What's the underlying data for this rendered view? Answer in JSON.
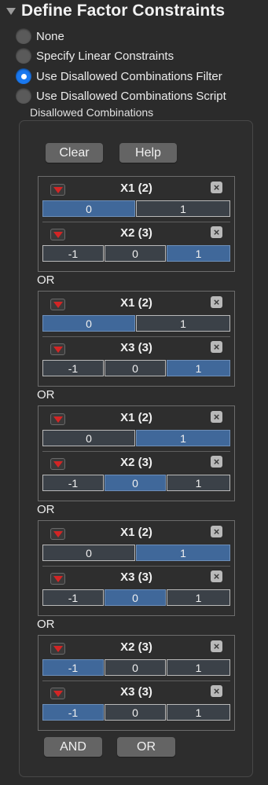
{
  "header": {
    "title": "Define Factor Constraints"
  },
  "radios": [
    {
      "label": "None",
      "selected": false
    },
    {
      "label": "Specify Linear Constraints",
      "selected": false
    },
    {
      "label": "Use Disallowed Combinations Filter",
      "selected": true
    },
    {
      "label": "Use Disallowed Combinations Script",
      "selected": false
    }
  ],
  "disallowed_label": "Disallowed Combinations",
  "toolbar": {
    "clear_label": "Clear",
    "help_label": "Help"
  },
  "or_label": "OR",
  "groups": [
    {
      "factors": [
        {
          "name": "X1 (2)",
          "levels": [
            "0",
            "1"
          ],
          "selected": 0
        },
        {
          "name": "X2 (3)",
          "levels": [
            "-1",
            "0",
            "1"
          ],
          "selected": 2
        }
      ]
    },
    {
      "factors": [
        {
          "name": "X1 (2)",
          "levels": [
            "0",
            "1"
          ],
          "selected": 0
        },
        {
          "name": "X3 (3)",
          "levels": [
            "-1",
            "0",
            "1"
          ],
          "selected": 2
        }
      ]
    },
    {
      "factors": [
        {
          "name": "X1 (2)",
          "levels": [
            "0",
            "1"
          ],
          "selected": 1
        },
        {
          "name": "X2 (3)",
          "levels": [
            "-1",
            "0",
            "1"
          ],
          "selected": 1
        }
      ]
    },
    {
      "factors": [
        {
          "name": "X1 (2)",
          "levels": [
            "0",
            "1"
          ],
          "selected": 1
        },
        {
          "name": "X3 (3)",
          "levels": [
            "-1",
            "0",
            "1"
          ],
          "selected": 1
        }
      ]
    },
    {
      "factors": [
        {
          "name": "X2 (3)",
          "levels": [
            "-1",
            "0",
            "1"
          ],
          "selected": 0
        },
        {
          "name": "X3 (3)",
          "levels": [
            "-1",
            "0",
            "1"
          ],
          "selected": 0
        }
      ]
    }
  ],
  "footer": {
    "and_label": "AND",
    "or_label": "OR"
  },
  "colors": {
    "selected_level": "#40689a",
    "radio_selected": "#1a78ef",
    "menu_arrow": "#d22525"
  }
}
